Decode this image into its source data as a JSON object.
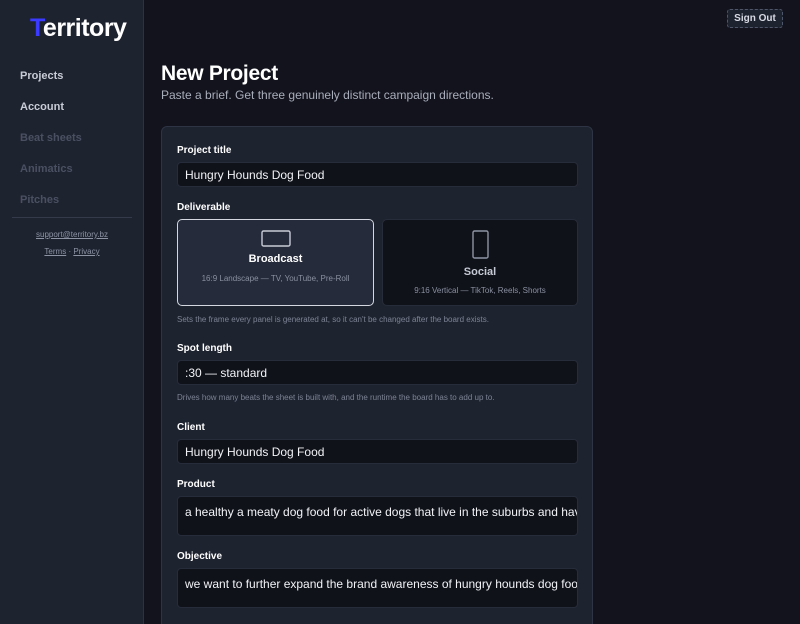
{
  "sidebar": {
    "logo_first": "T",
    "logo_rest": "erritory",
    "items": [
      {
        "label": "Projects",
        "enabled": true
      },
      {
        "label": "Account",
        "enabled": true
      },
      {
        "label": "Beat sheets",
        "enabled": false
      },
      {
        "label": "Animatics",
        "enabled": false
      },
      {
        "label": "Pitches",
        "enabled": false
      }
    ],
    "support_email": "support@territory.bz",
    "terms": "Terms",
    "separator": "·",
    "privacy": "Privacy"
  },
  "header": {
    "sign_out": "Sign Out",
    "title": "New Project",
    "subtitle": "Paste a brief. Get three genuinely distinct campaign directions."
  },
  "form": {
    "project_title_label": "Project title",
    "project_title_value": "Hungry Hounds Dog Food",
    "deliverable_label": "Deliverable",
    "deliverables": [
      {
        "title": "Broadcast",
        "subtitle": "16:9 Landscape — TV, YouTube, Pre-Roll",
        "selected": true,
        "icon": "landscape-frame-icon"
      },
      {
        "title": "Social",
        "subtitle": "9:16 Vertical — TikTok, Reels, Shorts",
        "selected": false,
        "icon": "portrait-frame-icon"
      }
    ],
    "deliverable_helper": "Sets the frame every panel is generated at, so it can't be changed after the board exists.",
    "spot_length_label": "Spot length",
    "spot_length_value": ":30 — standard",
    "spot_length_helper": "Drives how many beats the sheet is built with, and the runtime the board has to add up to.",
    "client_label": "Client",
    "client_value": "Hungry Hounds Dog Food",
    "product_label": "Product",
    "product_value": "a healthy a meaty dog food for active dogs that live in the suburbs and have",
    "objective_label": "Objective",
    "objective_value": "we want to further expand the brand awareness of hungry hounds dog food"
  },
  "colors": {
    "background": "#12131c",
    "sidebar": "#1e2330",
    "accent": "#3b3bff"
  }
}
